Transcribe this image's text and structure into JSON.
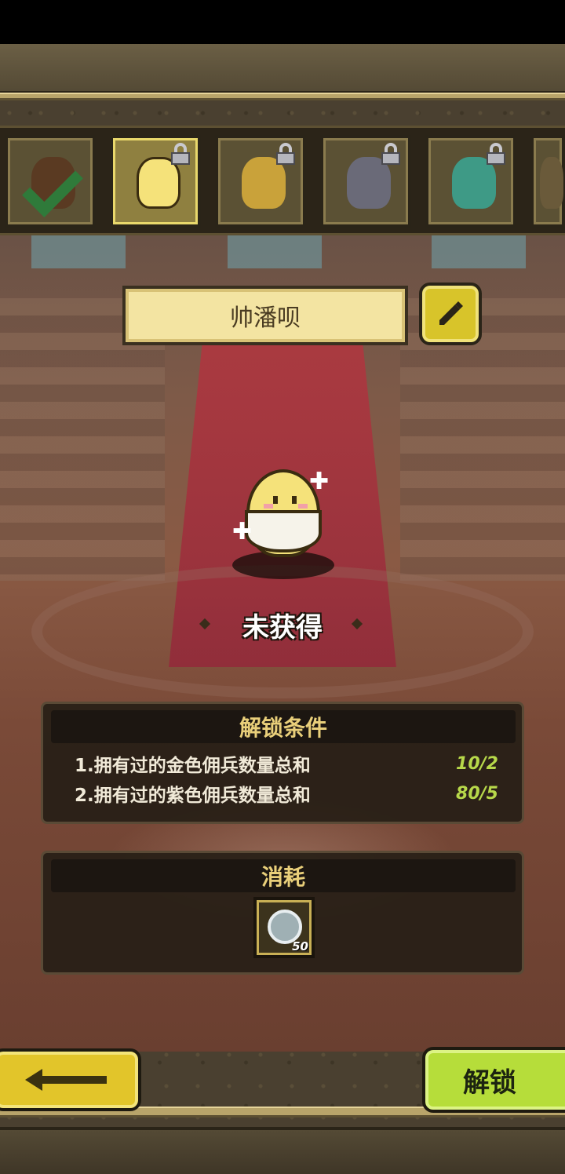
{
  "character_tabs": [
    {
      "state": "owned",
      "avatar_color": "#5a3a22"
    },
    {
      "state": "locked-selected",
      "avatar_color": "#f5e27a"
    },
    {
      "state": "locked",
      "avatar_color": "#c9a23a"
    },
    {
      "state": "locked",
      "avatar_color": "#6a6a78"
    },
    {
      "state": "locked",
      "avatar_color": "#3e9a86"
    },
    {
      "state": "locked",
      "avatar_color": "#6a5a3a"
    }
  ],
  "character": {
    "name": "帅潘呗",
    "status": "未获得"
  },
  "unlock_conditions": {
    "title": "解锁条件",
    "items": [
      {
        "text": "1.拥有过的金色佣兵数量总和",
        "progress": "10/2"
      },
      {
        "text": "2.拥有过的紫色佣兵数量总和",
        "progress": "80/5"
      }
    ]
  },
  "cost": {
    "title": "消耗",
    "item": {
      "icon": "shirt-token-icon",
      "quantity": "50"
    }
  },
  "buttons": {
    "unlock_label": "解锁"
  },
  "colors": {
    "accent_yellow": "#e2c52a",
    "accent_green": "#b6dd3a",
    "progress_green": "#b7d84a",
    "header_gold": "#e9cf7a"
  }
}
